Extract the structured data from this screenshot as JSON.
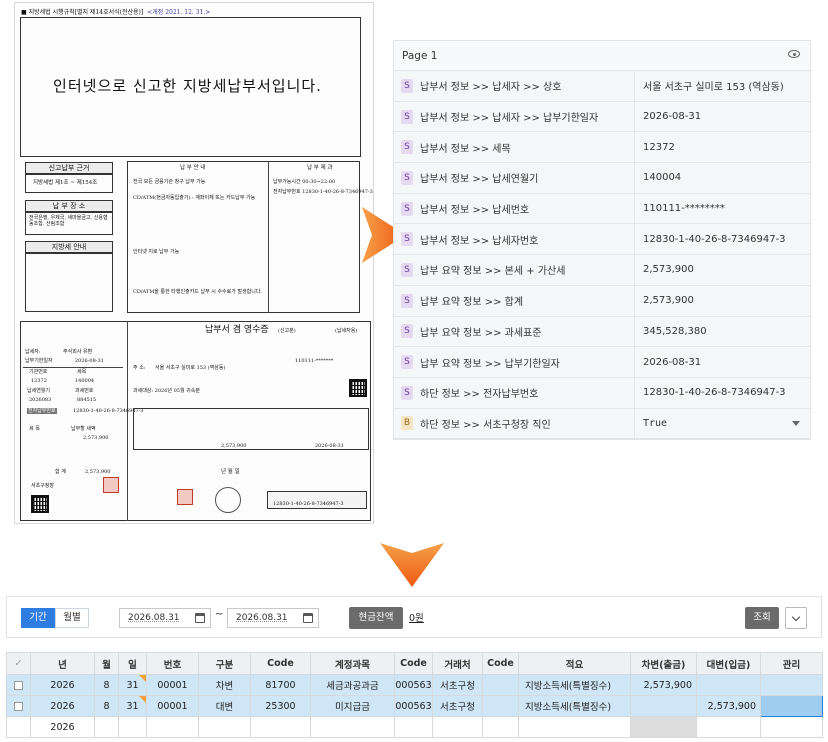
{
  "document": {
    "header": "■ 지방세법 시행규칙[별지 제14호서식(전산용)]",
    "revision": "<개정 2021. 12. 31.>",
    "title": "인터넷으로 신고한 지방세납부서입니다.",
    "left_sections": {
      "filing_basis": "신고납부 근거",
      "filing_basis_value": "지방세법 제1조 ~ 제154조",
      "payment_place": "납 부 장 소",
      "payment_place_value": "전국은행, 우체국, 새마을금고, 신용협동조합, 산림조합",
      "local_tax_info": "지방세 안내"
    },
    "guide": {
      "title": "납 부 안 내",
      "items": [
        "전국 모든 금융기관 창구 납부 가능",
        "CD/ATM(현금자동입출기) : 계좌이체 또는 카드납부 가능",
        "인터넷 지로 납부 가능",
        "CD/ATM을 통한 타행인출카드 납부 시 수수료가 발생합니다."
      ],
      "result_title": "납 부 제 과",
      "result_time": "납부가능시간 00:30~22:00",
      "result_number": "전자납부번호 12830-1-40-26-8-7346947-3"
    },
    "receipt": {
      "title": "납부서 겸 영수증",
      "subtitle": "(신고분)",
      "taxpayer_copy": "(납세자용)",
      "label_payer": "납세자:",
      "payer_value": "주식회사 유환",
      "label_due": "납부기한일자",
      "due_value": "2026-08-31",
      "label_code": "기관번호",
      "label_item": "세목",
      "code_value": "12372",
      "item_value": "140004",
      "label_year": "납세연월기",
      "label_taxno": "과세번호",
      "year_value": "2026083",
      "taxno_value": "884515",
      "label_epay": "전자납부번호",
      "epay_value": "12830-1-40-26-8-7346947-3",
      "label_taxitem": "세 목",
      "label_amount": "납부할 세액",
      "amount_value": "2,573,900",
      "label_total": "합 계",
      "total_value": "2,573,900",
      "office": "서초구청장",
      "addr_label": "주 소:",
      "addr_value": "서울 서초구 실미로 153 (역삼동)",
      "tax_target": "과세대상: 2026년 05월 귀속분",
      "grid_total": "2,573,900",
      "grid_due": "2026-08-31",
      "year_label": "년 월 일",
      "epay_box": "12830-1-40-26-8-7346947-3",
      "reg_no": "110111-*******"
    }
  },
  "panel": {
    "page_label": "Page 1",
    "fields": [
      {
        "type": "S",
        "name": "납부서 정보 >> 납세자 >> 상호",
        "value": "서울 서초구 실미로 153 (역삼동)"
      },
      {
        "type": "S",
        "name": "납부서 정보 >> 납세자 >> 납부기한일자",
        "value": "2026-08-31"
      },
      {
        "type": "S",
        "name": "납부서 정보 >> 세목",
        "value": "12372"
      },
      {
        "type": "S",
        "name": "납부서 정보 >> 납세연월기",
        "value": "140004"
      },
      {
        "type": "S",
        "name": "납부서 정보 >> 납세번호",
        "value": "110111-********"
      },
      {
        "type": "S",
        "name": "납부서 정보 >> 납세자번호",
        "value": "12830-1-40-26-8-7346947-3"
      },
      {
        "type": "S",
        "name": "납부 요약 정보 >> 본세 + 가산세",
        "value": "2,573,900"
      },
      {
        "type": "S",
        "name": "납부 요약 정보 >> 합계",
        "value": "2,573,900"
      },
      {
        "type": "S",
        "name": "납부 요약 정보 >> 과세표준",
        "value": "345,528,380"
      },
      {
        "type": "S",
        "name": "납부 요약 정보 >> 납부기한일자",
        "value": "2026-08-31"
      },
      {
        "type": "S",
        "name": "하단 정보 >> 전자납부번호",
        "value": "12830-1-40-26-8-7346947-3"
      },
      {
        "type": "B",
        "name": "하단 정보 >> 서초구청장 직인",
        "value": "True"
      }
    ]
  },
  "ledger": {
    "toolbar": {
      "tab_period": "기간",
      "tab_monthly": "월별",
      "date_from": "2026.08.31",
      "date_to": "2026.08.31",
      "tilde": "~",
      "cash_balance": "현금잔액",
      "zero": "0원",
      "search": "조회"
    },
    "columns": [
      "✓",
      "년",
      "월",
      "일",
      "번호",
      "구분",
      "Code",
      "계정과목",
      "Code",
      "거래처",
      "Code",
      "적요",
      "차변(출금)",
      "대변(입금)",
      "관리"
    ],
    "rows": [
      {
        "year": "2026",
        "month": "8",
        "day": "31",
        "no": "00001",
        "type": "차변",
        "code": "81700",
        "account": "세금과공과금",
        "vcode": "000563",
        "vendor": "서초구청",
        "acode": "",
        "memo": "지방소득세(특별징수)",
        "debit": "2,573,900",
        "credit": "",
        "mgmt": ""
      },
      {
        "year": "2026",
        "month": "8",
        "day": "31",
        "no": "00001",
        "type": "대변",
        "code": "25300",
        "account": "미지급금",
        "vcode": "000563",
        "vendor": "서초구청",
        "acode": "",
        "memo": "지방소득세(특별징수)",
        "debit": "",
        "credit": "2,573,900",
        "mgmt": ""
      },
      {
        "year": "2026",
        "month": "",
        "day": "",
        "no": "",
        "type": "",
        "code": "",
        "account": "",
        "vcode": "",
        "vendor": "",
        "acode": "",
        "memo": "",
        "debit": "",
        "credit": "",
        "mgmt": ""
      }
    ]
  },
  "colors": {
    "accent": "#2f7de1",
    "arrow": "#f26a1b",
    "selected_row": "#cfe6f7",
    "badge_s": "#6a3fa0",
    "badge_b": "#9a6a10"
  }
}
